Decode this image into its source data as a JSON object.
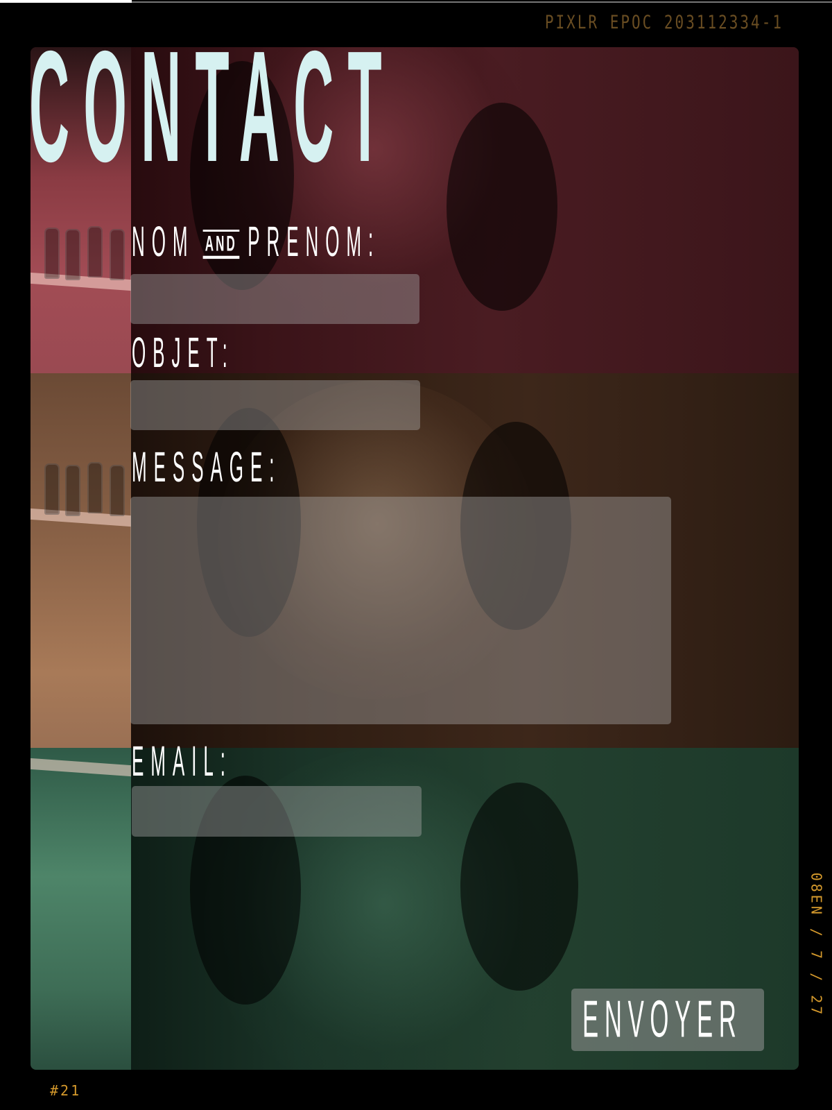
{
  "frame": {
    "code": "PIXLR EPOC 203112334-1",
    "side_code": "08EN / 7 / 27",
    "number": "#21"
  },
  "page": {
    "title": "CONTACT"
  },
  "form": {
    "name_label_a": "NOM",
    "name_label_and": "AND",
    "name_label_b": "PRENOM:",
    "name_value": "",
    "subject_label": "OBJET:",
    "subject_value": "",
    "message_label": "MESSAGE:",
    "message_value": "",
    "email_label": "EMAIL:",
    "email_value": "",
    "submit_label": "ENVOYER"
  },
  "colors": {
    "title": "#d6f1f1",
    "label": "#ffffff",
    "field_bg": "rgba(170,170,170,.42)",
    "band_top": "#4a1c22",
    "band_middle": "#3d271a",
    "band_bottom": "#23402f",
    "frame_text": "#d69a2c"
  }
}
